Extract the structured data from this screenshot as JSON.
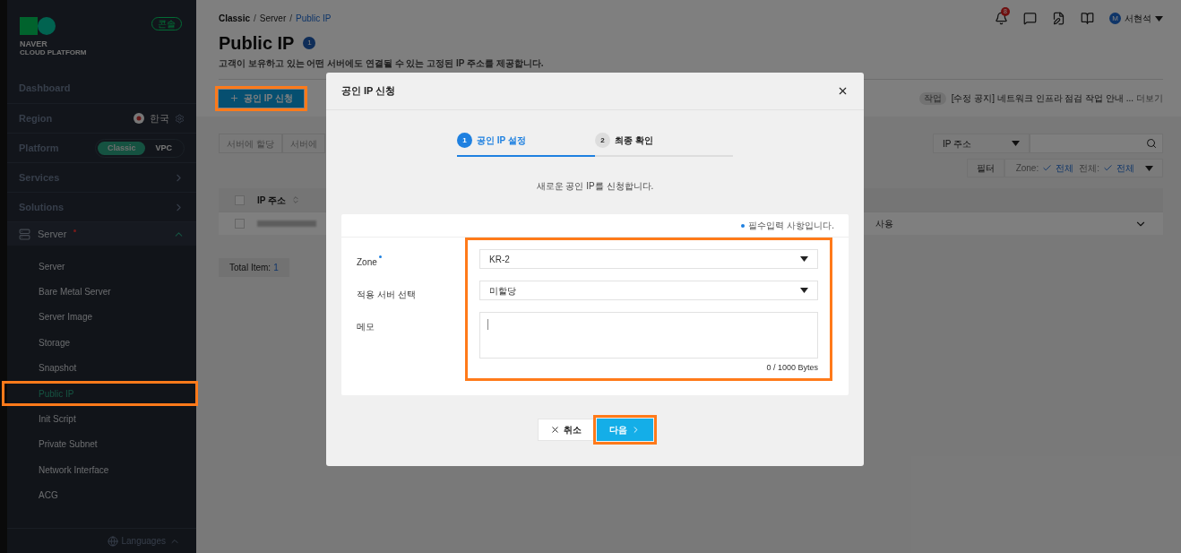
{
  "sidebar": {
    "logo": {
      "line_1": "NAVER",
      "line_2": "CLOUD PLATFORM"
    },
    "badge": "콘솔",
    "rows": [
      {
        "kind": "link",
        "label": "Dashboard"
      },
      {
        "kind": "region",
        "label": "Region",
        "value": "한국"
      },
      {
        "kind": "platform",
        "label": "Platform",
        "options": [
          {
            "label": "Classic",
            "selected": true
          },
          {
            "label": "VPC",
            "selected": false
          }
        ]
      },
      {
        "kind": "menu",
        "label": "Services"
      },
      {
        "kind": "menu",
        "label": "Solutions"
      }
    ],
    "group": {
      "label": "Server",
      "expanded": true,
      "has_alert": true,
      "children": [
        {
          "label": "Server",
          "selected": false,
          "highlighted": false
        },
        {
          "label": "Bare Metal Server",
          "selected": false,
          "highlighted": false
        },
        {
          "label": "Server Image",
          "selected": false,
          "highlighted": false
        },
        {
          "label": "Storage",
          "selected": false,
          "highlighted": false
        },
        {
          "label": "Snapshot",
          "selected": false,
          "highlighted": false
        },
        {
          "label": "Public IP",
          "selected": true,
          "highlighted": true
        },
        {
          "label": "Init Script",
          "selected": false,
          "highlighted": false
        },
        {
          "label": "Private Subnet",
          "selected": false,
          "highlighted": false
        },
        {
          "label": "Network Interface",
          "selected": false,
          "highlighted": false
        },
        {
          "label": "ACG",
          "selected": false,
          "highlighted": false
        }
      ]
    },
    "languages": "Languages"
  },
  "header": {
    "notifications": "8",
    "user_initial": "M",
    "user_name": "서현석"
  },
  "breadcrumb": [
    {
      "label": "Classic",
      "separator": "/",
      "current": false
    },
    {
      "label": "Server",
      "separator": "/",
      "current": false
    },
    {
      "label": "Public IP",
      "current": true
    }
  ],
  "page": {
    "title": "Public IP",
    "info_badge": "1",
    "description": "고객이 보유하고 있는 어떤 서버에도 연결될 수 있는 고정된 IP 주소를 제공합니다."
  },
  "actions": {
    "create_button": {
      "label": "공인 IP 신청",
      "highlighted": true
    },
    "notice": {
      "tag": "작업",
      "text": "[수정 공지] 네트워크 인프라 점검 작업 안내 ...",
      "more": "더보기"
    }
  },
  "tabs": [
    {
      "label": "서버에 할당"
    },
    {
      "label": "서버에"
    }
  ],
  "search": {
    "field": "IP 주소"
  },
  "filter": {
    "label": "필터",
    "items": [
      {
        "name": "Zone:",
        "value": "전체"
      },
      {
        "name": "전체:",
        "value": "전체"
      }
    ]
  },
  "table": {
    "select_all": {
      "checked": false
    },
    "columns": [
      "IP 주소"
    ],
    "rows": [
      {
        "status": "사용",
        "checked": false
      }
    ],
    "total_label": "Total Item:",
    "total": "1"
  },
  "dialog": {
    "title": "공인 IP 신청",
    "steps": [
      {
        "number": "1",
        "label": "공인 IP 설정",
        "selected": true
      },
      {
        "number": "2",
        "label": "최종 확인",
        "selected": false
      }
    ],
    "intro": "새로운 공인 IP를 신청합니다.",
    "required_note": "필수입력 사항입니다.",
    "fields_highlighted": true,
    "fields": [
      {
        "kind": "select",
        "label": "Zone",
        "required": true,
        "value": "KR-2"
      },
      {
        "kind": "select",
        "label": "적용 서버 선택",
        "required": false,
        "value": "미할당"
      },
      {
        "kind": "textarea",
        "label": "메모",
        "required": false,
        "counter": "0 / 1000 Bytes"
      }
    ],
    "cancel": "취소",
    "next": {
      "label": "다음",
      "highlighted": true
    }
  }
}
